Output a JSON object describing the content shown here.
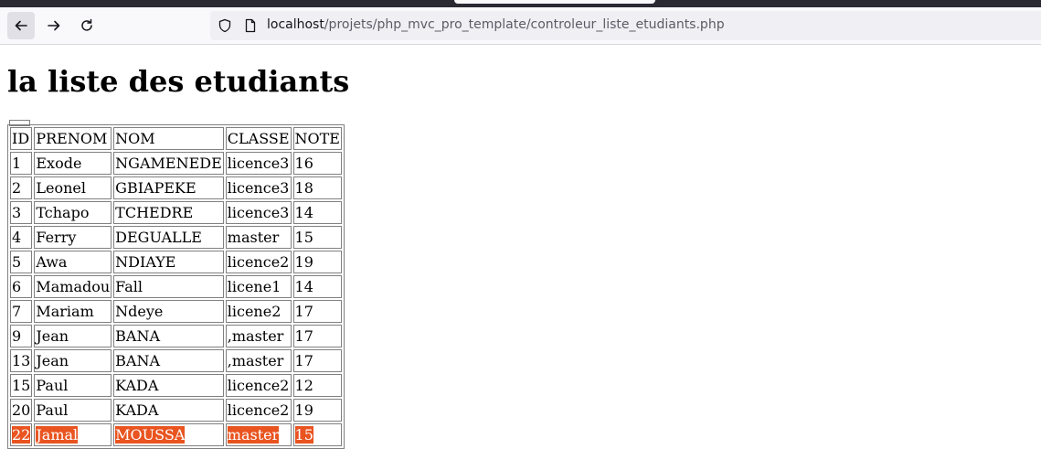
{
  "browser": {
    "url_host": "localhost",
    "url_path": "/projets/php_mvc_pro_template/controleur_liste_etudiants.php",
    "icons": {
      "back": "arrow-left-icon",
      "forward": "arrow-right-icon",
      "reload": "reload-icon",
      "security": "shield-icon",
      "page": "page-icon"
    }
  },
  "page": {
    "title": "la liste des etudiants"
  },
  "table": {
    "headers": [
      "ID",
      "PRENOM",
      "NOM",
      "CLASSE",
      "NOTE"
    ],
    "rows": [
      [
        "1",
        "Exode",
        "NGAMENEDE",
        "licence3",
        "16"
      ],
      [
        "2",
        "Leonel",
        "GBIAPEKE",
        "licence3",
        "18"
      ],
      [
        "3",
        "Tchapo",
        "TCHEDRE",
        "licence3",
        "14"
      ],
      [
        "4",
        "Ferry",
        "DEGUALLE",
        "master",
        "15"
      ],
      [
        "5",
        "Awa",
        "NDIAYE",
        "licence2",
        "19"
      ],
      [
        "6",
        "Mamadou",
        "Fall",
        "licene1",
        "14"
      ],
      [
        "7",
        "Mariam",
        "Ndeye",
        "licene2",
        "17"
      ],
      [
        "9",
        "Jean",
        "BANA",
        ",master",
        "17"
      ],
      [
        "13",
        "Jean",
        "BANA",
        ",master",
        "17"
      ],
      [
        "15",
        "Paul",
        "KADA",
        "licence2",
        "12"
      ],
      [
        "20",
        "Paul",
        "KADA",
        "licence2",
        "19"
      ],
      [
        "22",
        "Jamal",
        "MOUSSA",
        "master",
        "15"
      ]
    ],
    "highlight_row": 11,
    "highlight_color": "#e95420"
  }
}
